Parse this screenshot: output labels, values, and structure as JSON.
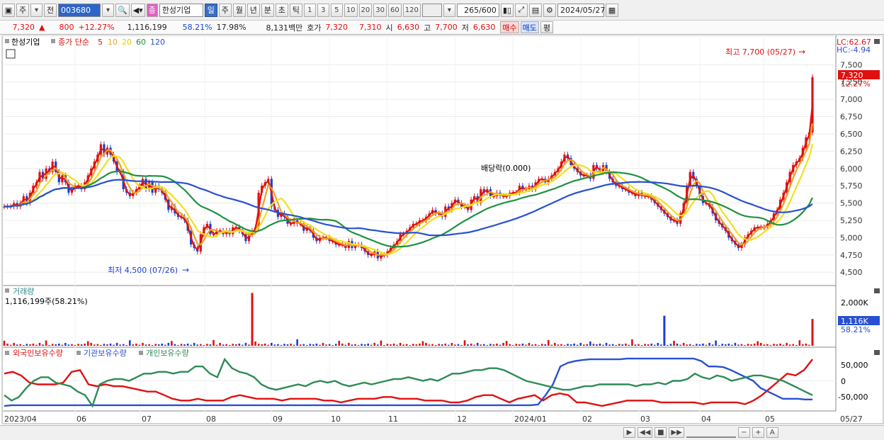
{
  "toolbar": {
    "period_btn": "주",
    "prev_btn": "전",
    "code": "003680",
    "name": "한성기업",
    "chip": "종",
    "periods": [
      "일",
      "주",
      "월",
      "년",
      "분",
      "초",
      "틱"
    ],
    "minutes": [
      "1",
      "3",
      "5",
      "10",
      "20",
      "30",
      "60",
      "120"
    ],
    "count": "265",
    "count_total": "/600",
    "date": "2024/05/27"
  },
  "quote": {
    "price": "7,320",
    "arrow": "▲",
    "change": "800",
    "pct": "+12.27%",
    "volume": "1,116,199",
    "vol_ratio": "58.21%",
    "turnover": "17.98%",
    "amount": "8,131백만",
    "hoga_label": "호가",
    "ask": "7,320",
    "bid": "7,310",
    "open_label": "시",
    "open": "6,630",
    "high_label": "고",
    "high": "7,700",
    "low_label": "저",
    "low": "6,630",
    "buy": "매수",
    "sell": "매도",
    "avg": "평"
  },
  "price_panel": {
    "stock": "한성기업",
    "ma_title": "종가 단순",
    "ma": [
      "5",
      "10",
      "20",
      "60",
      "120"
    ],
    "ma_colors": [
      "#e01010",
      "#f0a020",
      "#f0e020",
      "#209040",
      "#2850d0"
    ],
    "lc": "LC:62.67",
    "hc": "HC:-4.94",
    "y_ticks": [
      "7,500",
      "7,250",
      "7,000",
      "6,750",
      "6,500",
      "6,250",
      "6,000",
      "5,750",
      "5,500",
      "5,250",
      "5,000",
      "4,750",
      "4,500"
    ],
    "last_price": "7,320",
    "last_pct": "12.27%",
    "hi_note": "최고 7,700 (05/27)",
    "lo_note": "최저 4,500 (07/26)",
    "event": "배당락(0.000)"
  },
  "volume_panel": {
    "title": "거래량",
    "value": "1,116,199주(58.21%)",
    "y_ticks": [
      "2,000K",
      "1,000K"
    ],
    "last": "1,116K",
    "last_pct": "58.21%"
  },
  "holding_panel": {
    "titles": [
      "외국인보유수량",
      "기관보유수량",
      "개인보유수량"
    ],
    "colors": [
      "#e01010",
      "#2850d0",
      "#2e8b57"
    ],
    "y_ticks": [
      "50,000",
      "0",
      "-50,000"
    ]
  },
  "x_labels": [
    "2023/04",
    "06",
    "07",
    "08",
    "09",
    "10",
    "11",
    "12",
    "2024/01",
    "02",
    "03",
    "04",
    "05",
    "05/27"
  ],
  "chart_data": {
    "type": "line",
    "series": [
      {
        "name": "종가",
        "values": [
          5450,
          5450,
          5450,
          5500,
          5450,
          5500,
          5600,
          5500,
          5650,
          5750,
          5800,
          5950,
          5850,
          6000,
          5950,
          6100,
          5950,
          5800,
          5900,
          5800,
          5650,
          5700,
          5750,
          5750,
          5700,
          5800,
          5900,
          6000,
          6100,
          6200,
          6350,
          6200,
          6300,
          6200,
          6100,
          5950,
          5950,
          5700,
          5650,
          5600,
          5650,
          5700,
          5750,
          5850,
          5700,
          5800,
          5650,
          5750,
          5700,
          5650,
          5550,
          5400,
          5450,
          5350,
          5300,
          5300,
          5250,
          5100,
          4900,
          4850,
          4800,
          5050,
          5150,
          5200,
          5050,
          5050,
          5100,
          5100,
          5050,
          5100,
          5050,
          5150,
          5150,
          5100,
          5050,
          4950,
          5050,
          5100,
          5150,
          5650,
          5750,
          5800,
          5850,
          5450,
          5400,
          5300,
          5350,
          5300,
          5200,
          5200,
          5250,
          5200,
          5200,
          5100,
          5150,
          5100,
          5000,
          4950,
          5000,
          5000,
          5000,
          4950,
          4950,
          4900,
          4900,
          4900,
          4850,
          4950,
          4850,
          4900,
          4900,
          4850,
          4800,
          4750,
          4750,
          4800,
          4700,
          4750,
          4750,
          4800,
          4850,
          4900,
          4950,
          5050,
          5050,
          5100,
          5150,
          5200,
          5200,
          5250,
          5250,
          5300,
          5350,
          5400,
          5350,
          5350,
          5300,
          5450,
          5400,
          5500,
          5550,
          5500,
          5450,
          5450,
          5400,
          5550,
          5600,
          5500,
          5700,
          5650,
          5700,
          5600,
          5600,
          5650,
          5600,
          5600,
          5600,
          5650,
          5650,
          5650,
          5750,
          5700,
          5700,
          5750,
          5700,
          5800,
          5850,
          5850,
          5800,
          5850,
          5900,
          5950,
          6000,
          6100,
          6200,
          6150,
          6050,
          6000,
          5950,
          5900,
          5900,
          5900,
          5850,
          6050,
          6000,
          5950,
          6050,
          5950,
          5850,
          5800,
          5750,
          5750,
          5700,
          5700,
          5650,
          5650,
          5600,
          5650,
          5600,
          5600,
          5600,
          5550,
          5500,
          5450,
          5400,
          5350,
          5300,
          5250,
          5250,
          5200,
          5350,
          5500,
          5750,
          5950,
          5850,
          5750,
          5600,
          5500,
          5500,
          5450,
          5350,
          5250,
          5200,
          5150,
          5100,
          5000,
          4950,
          4900,
          4850,
          4900,
          5000,
          5050,
          5100,
          5150,
          5150,
          5150,
          5150,
          5200,
          5250,
          5350,
          5400,
          5550,
          5650,
          5800,
          5950,
          6050,
          6100,
          6150,
          6300,
          6450,
          6520,
          7320
        ]
      },
      {
        "name": "외국인보유수량",
        "values": [
          20000,
          25000,
          15000,
          -5000,
          -10000,
          -10000,
          -10000,
          -5000,
          25000,
          30000,
          -10000,
          -15000,
          -10000,
          -15000,
          -15000,
          -20000,
          -25000,
          -30000,
          -30000,
          -40000,
          -50000,
          -55000,
          -55000,
          -50000,
          -55000,
          -55000,
          -55000,
          -45000,
          -40000,
          -45000,
          -50000,
          -50000,
          -50000,
          -55000,
          -50000,
          -50000,
          -50000,
          -50000,
          -55000,
          -55000,
          -60000,
          -55000,
          -50000,
          -50000,
          -50000,
          -45000,
          -45000,
          -50000,
          -50000,
          -50000,
          -55000,
          -55000,
          -55000,
          -60000,
          -60000,
          -55000,
          -45000,
          -40000,
          -40000,
          -50000,
          -60000,
          -50000,
          -45000,
          -40000,
          -55000,
          -40000,
          -35000,
          -40000,
          -60000,
          -60000,
          -65000,
          -70000,
          -65000,
          -60000,
          -55000,
          -55000,
          -55000,
          -55000,
          -60000,
          -60000,
          -60000,
          -60000,
          -60000,
          -65000,
          -60000,
          -60000,
          -60000,
          -60000,
          -65000,
          -55000,
          -40000,
          -20000,
          0,
          20000,
          15000,
          30000,
          60000
        ]
      },
      {
        "name": "기관보유수량",
        "values": [
          -70000,
          -68000,
          -68000,
          -68000,
          -68000,
          -68000,
          -68000,
          -68000,
          -68000,
          -68000,
          -68000,
          -68000,
          -68000,
          -68000,
          -68000,
          -68000,
          -68000,
          -68000,
          -68000,
          -68000,
          -68000,
          -68000,
          -68000,
          -68000,
          -68000,
          -68000,
          -68000,
          -68000,
          -68000,
          -68000,
          -68000,
          -68000,
          -68000,
          -68000,
          -68000,
          -68000,
          -68000,
          -68000,
          -68000,
          -68000,
          -68000,
          -68000,
          -68000,
          -68000,
          -68000,
          -68000,
          -68000,
          -68000,
          -68000,
          -68000,
          -68000,
          -68000,
          -68000,
          -68000,
          -68000,
          -68000,
          -68000,
          -68000,
          -68000,
          -68000,
          -68000,
          -68000,
          -68000,
          -68000,
          -68000,
          -68000,
          -68000,
          -68000,
          -68000,
          -68000,
          -68000,
          -68000,
          -66000,
          -40000,
          -10000,
          40000,
          50000,
          55000,
          58000,
          60000,
          60000,
          60000,
          60000,
          60000,
          62000,
          62000,
          62000,
          62000,
          62000,
          62000,
          62000,
          62000,
          62000,
          62000,
          55000,
          40000,
          40000,
          38000,
          30000,
          20000,
          10000,
          0,
          -20000,
          -30000,
          -40000,
          -50000,
          -50000,
          -50000,
          -52000,
          -52000
        ]
      },
      {
        "name": "개인보유수량",
        "values": [
          -40000,
          -55000,
          -45000,
          -20000,
          0,
          10000,
          10000,
          -5000,
          -10000,
          -15000,
          -30000,
          -40000,
          -70000,
          -10000,
          0,
          5000,
          5000,
          0,
          10000,
          20000,
          20000,
          25000,
          25000,
          20000,
          25000,
          25000,
          40000,
          40000,
          20000,
          10000,
          60000,
          35000,
          25000,
          20000,
          10000,
          -10000,
          -20000,
          -25000,
          -20000,
          -15000,
          -10000,
          -15000,
          -5000,
          0,
          -5000,
          0,
          -10000,
          -15000,
          -10000,
          -5000,
          -10000,
          -5000,
          0,
          5000,
          5000,
          10000,
          5000,
          0,
          5000,
          0,
          10000,
          20000,
          20000,
          25000,
          30000,
          30000,
          35000,
          35000,
          30000,
          20000,
          10000,
          0,
          -5000,
          -10000,
          -15000,
          -20000,
          -25000,
          -25000,
          -20000,
          -15000,
          -15000,
          -10000,
          -10000,
          -10000,
          -10000,
          -10000,
          -15000,
          -10000,
          -10000,
          -5000,
          -10000,
          0,
          0,
          5000,
          20000,
          10000,
          5000,
          15000,
          10000,
          0,
          5000,
          10000,
          15000,
          15000,
          10000,
          5000,
          0,
          -10000,
          -20000,
          -30000,
          -40000
        ]
      }
    ],
    "volume_spikes": [
      {
        "label": "2023/08",
        "value": 2200000
      },
      {
        "label": "2024/03",
        "value": 1250000
      },
      {
        "label": "05/27",
        "value": 1116199
      }
    ],
    "ylim_price": [
      4400,
      7800
    ],
    "ylim_volume": [
      0,
      2300000
    ],
    "ylim_holding": [
      -80000,
      70000
    ]
  }
}
